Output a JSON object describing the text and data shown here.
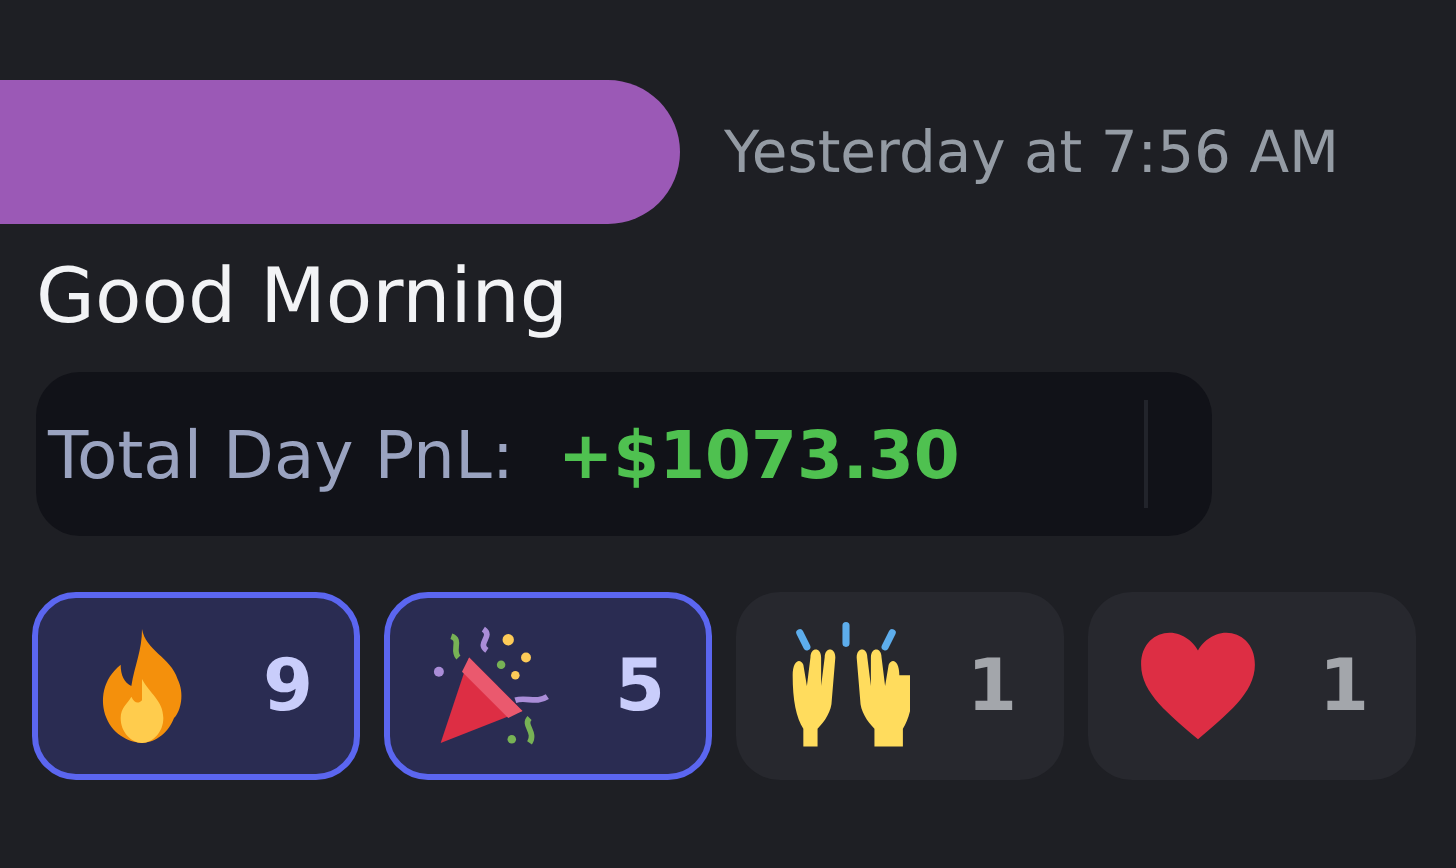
{
  "message": {
    "author": {
      "redacted": true
    },
    "timestamp": "Yesterday at 7:56 AM",
    "text": "Good Morning",
    "embed": {
      "label": "Total Day PnL:",
      "value": "+$1073.30"
    },
    "reactions": [
      {
        "kind": "fire",
        "count": "9",
        "selected": true
      },
      {
        "kind": "party",
        "count": "5",
        "selected": true
      },
      {
        "kind": "raised-hands",
        "count": "1",
        "selected": false
      },
      {
        "kind": "heart",
        "count": "1",
        "selected": false
      }
    ]
  }
}
